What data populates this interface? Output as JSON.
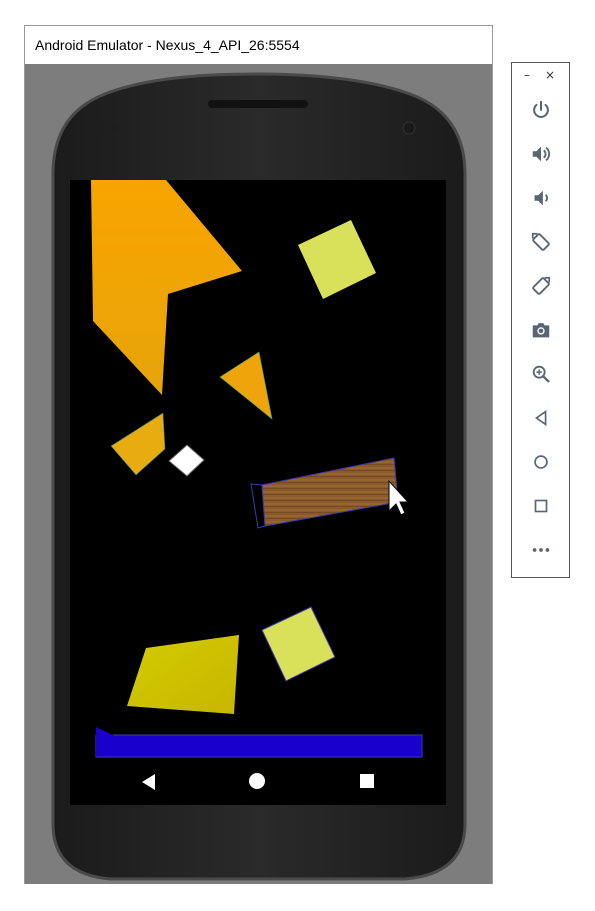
{
  "window": {
    "title": "Android Emulator - Nexus_4_API_26:5554"
  },
  "toolbar": {
    "minimize_label": "–",
    "close_label": "×",
    "buttons": [
      {
        "name": "power-icon"
      },
      {
        "name": "volume-up-icon"
      },
      {
        "name": "volume-down-icon"
      },
      {
        "name": "rotate-left-icon"
      },
      {
        "name": "rotate-right-icon"
      },
      {
        "name": "camera-icon"
      },
      {
        "name": "zoom-icon"
      },
      {
        "name": "back-icon"
      },
      {
        "name": "home-icon"
      },
      {
        "name": "overview-icon"
      },
      {
        "name": "more-icon"
      }
    ]
  },
  "screen": {
    "nav_bar": [
      "back-triangle-icon",
      "home-circle-icon",
      "recents-square-icon"
    ]
  },
  "colors": {
    "orange": "#f7a000",
    "yellow": "#d9e05a",
    "olive_yellow": "#c8c000",
    "wood": "#8b5a2b",
    "blue_bar": "#1a00cc",
    "screen_bg": "#000000"
  }
}
